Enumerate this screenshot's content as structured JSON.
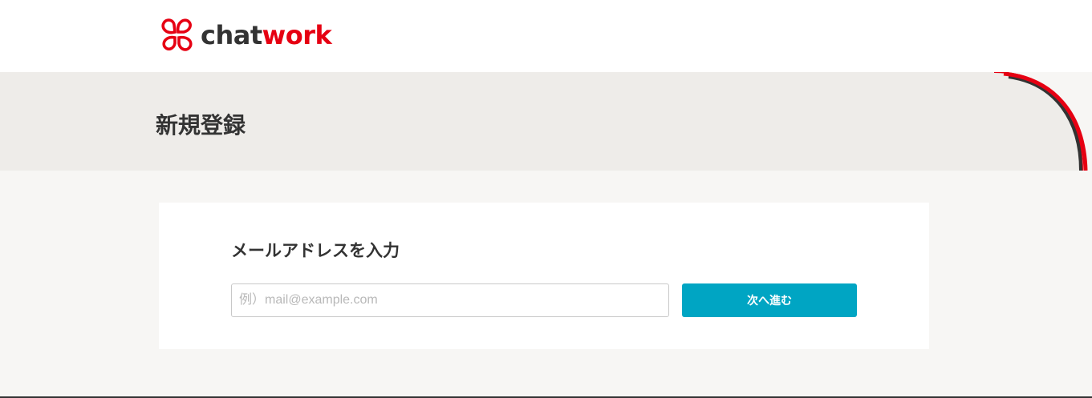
{
  "header": {
    "logo": {
      "icon": "chatwork-logo-icon",
      "text_part1": "chat",
      "text_part2": "work",
      "brand_color": "#e60012"
    }
  },
  "page": {
    "title": "新規登録"
  },
  "form": {
    "heading": "メールアドレスを入力",
    "email_placeholder": "例）mail@example.com",
    "email_value": "",
    "next_button_label": "次へ進む",
    "button_color": "#00a5c3"
  }
}
